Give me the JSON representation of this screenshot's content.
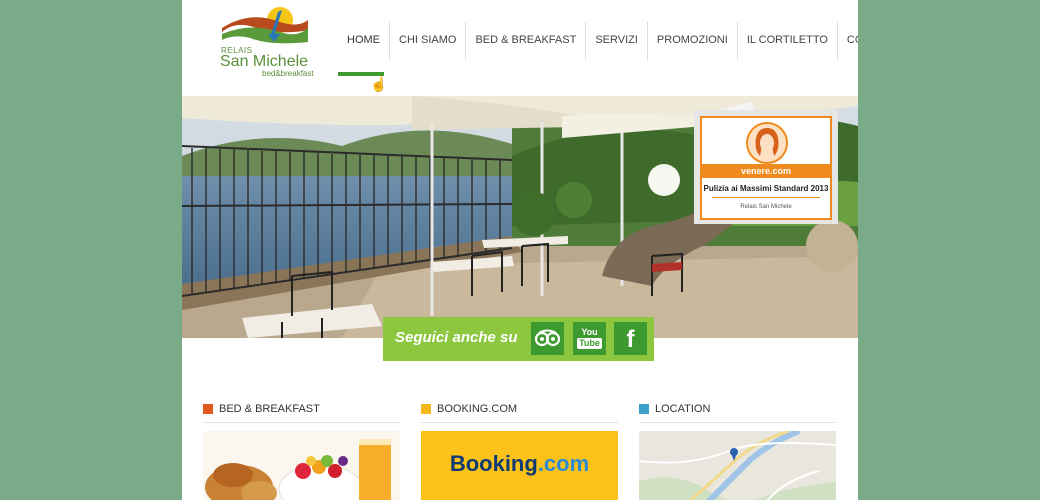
{
  "logo": {
    "line1": "RELAIS",
    "line2": "San Michele",
    "line3": "bed&breakfast"
  },
  "nav": {
    "items": [
      "HOME",
      "CHI SIAMO",
      "BED & BREAKFAST",
      "SERVIZI",
      "PROMOZIONI",
      "IL CORTILETTO",
      "CONTATTI"
    ],
    "active": "HOME"
  },
  "badge": {
    "brand": "venere.com",
    "award": "Pulizia ai Massimi Standard 2013",
    "hotel": "Relais San Michele"
  },
  "social": {
    "label": "Seguici anche su",
    "youtube_label_top": "You",
    "youtube_label_bottom": "Tube",
    "facebook_label": "f",
    "icons": [
      "tripadvisor-icon",
      "youtube-icon",
      "facebook-icon"
    ]
  },
  "sections": [
    {
      "title": "BED & BREAKFAST",
      "color": "#e05a1e"
    },
    {
      "title": "BOOKING.COM",
      "color": "#f2b81c"
    },
    {
      "title": "LOCATION",
      "color": "#3aa0c8"
    }
  ],
  "booking": {
    "brand": "Booking",
    "suffix": ".com"
  },
  "colors": {
    "background": "#7aab88",
    "accent_green": "#3c9a2e",
    "social_bar": "#8dc63f",
    "badge_orange": "#f08a1c"
  }
}
